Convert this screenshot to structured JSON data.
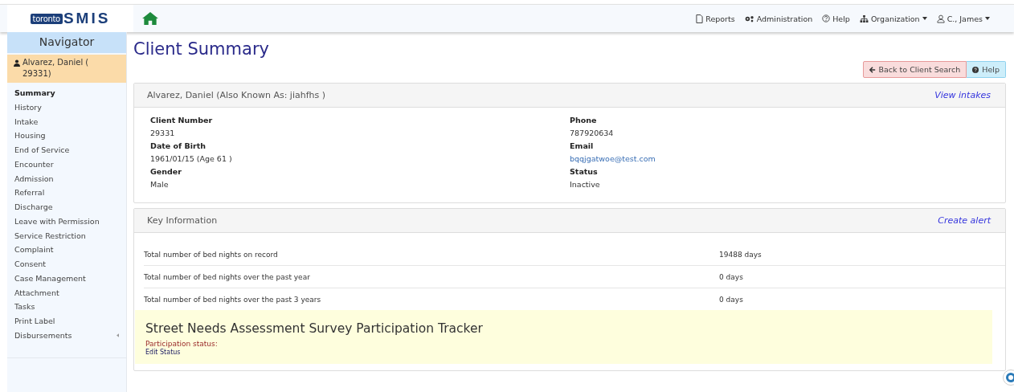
{
  "logo": {
    "badge": "toronto",
    "name": "SMIS"
  },
  "top_nav": [
    {
      "label": "Reports",
      "dropdown": false
    },
    {
      "label": "Administration",
      "dropdown": false
    },
    {
      "label": "Help",
      "dropdown": false
    },
    {
      "label": "Organization",
      "dropdown": true
    },
    {
      "label": "C., James",
      "dropdown": true
    }
  ],
  "sidebar": {
    "title": "Navigator",
    "client": "Alvarez, Daniel ( 29331)",
    "items": [
      {
        "label": "Summary",
        "selected": true
      },
      {
        "label": "History",
        "selected": false
      },
      {
        "label": "Intake",
        "selected": false
      },
      {
        "label": "Housing",
        "selected": false
      },
      {
        "label": "End of Service",
        "selected": false
      },
      {
        "label": "Encounter",
        "selected": false
      },
      {
        "label": "Admission",
        "selected": false
      },
      {
        "label": "Referral",
        "selected": false
      },
      {
        "label": "Discharge",
        "selected": false
      },
      {
        "label": "Leave with Permission",
        "selected": false
      },
      {
        "label": "Service Restriction",
        "selected": false
      },
      {
        "label": "Complaint",
        "selected": false
      },
      {
        "label": "Consent",
        "selected": false
      },
      {
        "label": "Case Management",
        "selected": false
      },
      {
        "label": "Attachment",
        "selected": false
      },
      {
        "label": "Tasks",
        "selected": false
      },
      {
        "label": "Print Label",
        "selected": false
      },
      {
        "label": "Disbursements",
        "selected": false
      }
    ]
  },
  "page_title": "Client Summary",
  "buttons": [
    {
      "label": "Back to Client Search",
      "kind": "danger"
    },
    {
      "label": "Help",
      "kind": "info"
    }
  ],
  "client_panel": {
    "title": "Alvarez, Daniel (Also Known As: jiahfhs )",
    "link": "View intakes",
    "fields": [
      {
        "label": "Client Number",
        "value": "29331",
        "kind": "text"
      },
      {
        "label": "Phone",
        "value": "787920634",
        "kind": "text"
      },
      {
        "label": "Date of Birth",
        "value": "1961/01/15 (Age 61 )",
        "kind": "text"
      },
      {
        "label": "Email",
        "value": "bqqjgatwoe@test.com",
        "kind": "link"
      },
      {
        "label": "Gender",
        "value": "Male",
        "kind": "text"
      },
      {
        "label": "Status",
        "value": "Inactive",
        "kind": "text"
      }
    ]
  },
  "key_panel": {
    "title": "Key Information",
    "link": "Create alert",
    "rows": [
      {
        "label": "Total number of bed nights on record",
        "value": "19488 days"
      },
      {
        "label": "Total number of bed nights over the past year",
        "value": "0 days"
      },
      {
        "label": "Total number of bed nights over the past 3 years",
        "value": "0 days"
      }
    ],
    "tracker": {
      "title": "Street Needs Assessment Survey Participation Tracker",
      "status_label": "Participation status:",
      "link": "Edit Status"
    }
  }
}
